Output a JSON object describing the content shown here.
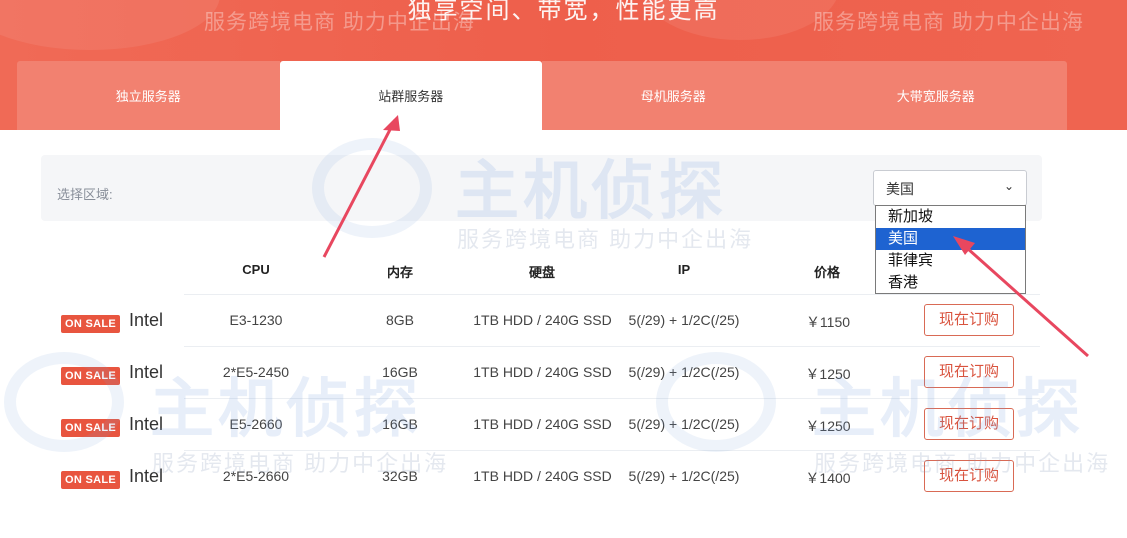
{
  "hero": {
    "tagline": "独享空间、带宽，性能更高",
    "watermark": "服务跨境电商 助力中企出海"
  },
  "tabs": [
    {
      "label": "独立服务器",
      "active": false
    },
    {
      "label": "站群服务器",
      "active": true
    },
    {
      "label": "母机服务器",
      "active": false
    },
    {
      "label": "大带宽服务器",
      "active": false
    }
  ],
  "filter": {
    "label": "选择区域:",
    "selected": "美国",
    "options": [
      "新加坡",
      "美国",
      "菲律宾",
      "香港"
    ]
  },
  "table": {
    "headers": [
      "CPU",
      "内存",
      "硬盘",
      "IP",
      "价格"
    ],
    "rows": [
      {
        "badge": "ON SALE",
        "brand": "Intel",
        "cpu": "E3-1230",
        "memory": "8GB",
        "disk": "1TB HDD / 240G SSD",
        "ip": "5(/29) + 1/2C(/25)",
        "price": "￥1150",
        "action": "现在订购"
      },
      {
        "badge": "ON SALE",
        "brand": "Intel",
        "cpu": "2*E5-2450",
        "memory": "16GB",
        "disk": "1TB HDD / 240G SSD",
        "ip": "5(/29) + 1/2C(/25)",
        "price": "￥1250",
        "action": "现在订购"
      },
      {
        "badge": "ON SALE",
        "brand": "Intel",
        "cpu": "E5-2660",
        "memory": "16GB",
        "disk": "1TB HDD / 240G SSD",
        "ip": "5(/29) + 1/2C(/25)",
        "price": "￥1250",
        "action": "现在订购"
      },
      {
        "badge": "ON SALE",
        "brand": "Intel",
        "cpu": "2*E5-2660",
        "memory": "32GB",
        "disk": "1TB HDD / 240G SSD",
        "ip": "5(/29) + 1/2C(/25)",
        "price": "￥1400",
        "action": "现在订购"
      }
    ]
  },
  "watermark": {
    "brand": "主机侦探",
    "slogan": "服务跨境电商 助力中企出海"
  },
  "colors": {
    "hero": "#ee5f4b",
    "tab_inactive": "#f28170",
    "sale_badge": "#e8553f",
    "select_highlight": "#1e63d1",
    "arrow": "#e8475f"
  }
}
